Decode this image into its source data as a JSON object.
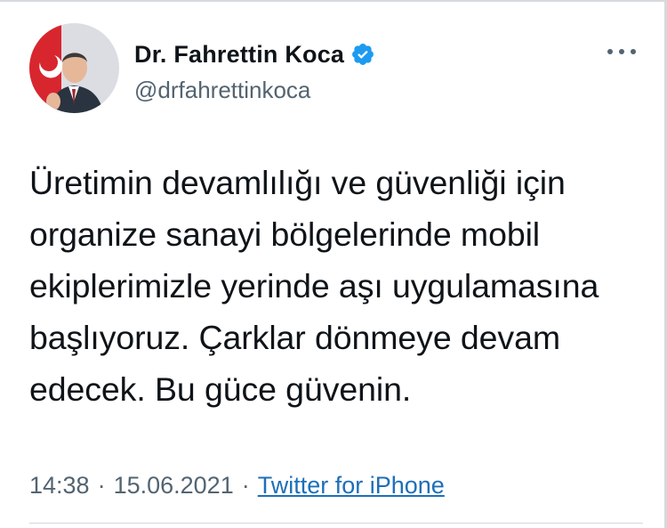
{
  "author": {
    "display_name": "Dr. Fahrettin Koca",
    "handle": "@drfahrettinkoca",
    "avatar_icon": "profile-photo",
    "verified_icon": "verified-badge-icon",
    "verified_color": "#1d9bf0"
  },
  "tweet": {
    "text": "Üretimin devamlılığı ve güvenliği için\norganize sanayi bölgelerinde mobil\nekiplerimizle yerinde aşı uygulamasına\nbaşlıyoruz. Çarklar dönmeye devam\nedecek. Bu güce güvenin."
  },
  "meta": {
    "time": "14:38",
    "separator": "·",
    "date": "15.06.2021",
    "source": "Twitter for iPhone"
  },
  "menu": {
    "icon": "more-options-icon"
  },
  "colors": {
    "text": "#0f1419",
    "secondary": "#536471",
    "link": "#1d6fb8"
  }
}
